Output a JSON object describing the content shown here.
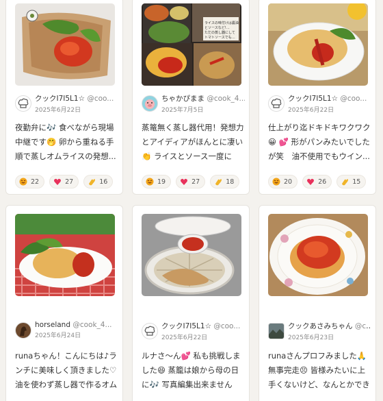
{
  "cards": [
    {
      "author": "クックI7I5L1☆",
      "uid": "@coo...",
      "date": "2025年6月22日",
      "text": "夜勤弁に🎶 食べながら現場中継です🤭 卵から重ねる手順で蒸しオムライスの発想...",
      "reactions": [
        "22",
        "27",
        "16"
      ],
      "avatar_icon": "chef-hat-icon"
    },
    {
      "author": "ちゃかぴまま",
      "uid": "@cook_4...",
      "date": "2025年7月5日",
      "text": "蒸篭無く蒸し器代用！発想力とアイディアがほんとに凄い👏 ライスとソース一度に仕...",
      "reactions": [
        "19",
        "27",
        "18"
      ],
      "avatar_icon": "pig-avatar-icon",
      "photo_caption": "ライスの味付けは醤油とソースなど!… ただの蒸し器にしてトマトソースでもさせていただきました!"
    },
    {
      "author": "クックI7I5L1☆",
      "uid": "@coo...",
      "date": "2025年6月22日",
      "text": "仕上がり迄ドキドキワクワク😀 💕 形がパンみたいでしたが笑　油不使用でもウイン...",
      "reactions": [
        "20",
        "26",
        "15"
      ],
      "avatar_icon": "chef-hat-icon"
    },
    {
      "author": "horseland",
      "uid": "@cook_4...",
      "date": "2025年6月24日",
      "text": "runaちゃん！こんにちは♪ランチに美味しく頂きました♡油を使わず蒸し器で作るオムライ...",
      "reactions": [],
      "avatar_icon": "horse-avatar-icon"
    },
    {
      "author": "クックI7I5L1☆",
      "uid": "@coo...",
      "date": "2025年6月22日",
      "text": "ルナさ～ん💕 私も挑戦しました😆 蒸籠は娘から母の日に🎶 写真編集出来ませんが...",
      "reactions": [],
      "avatar_icon": "chef-hat-icon"
    },
    {
      "author": "クックあさみちゃん",
      "uid": "@co...",
      "date": "2025年6月23日",
      "text": "runaさんプロフみました🙏 無事完走😣 皆様みたいに上手くないけど、なんとかできまし...",
      "reactions": [],
      "avatar_icon": "landscape-avatar-icon"
    }
  ],
  "colors": {
    "heart": "#e8315b",
    "laugh": "#f2a51a",
    "clap": "#f0b429"
  }
}
